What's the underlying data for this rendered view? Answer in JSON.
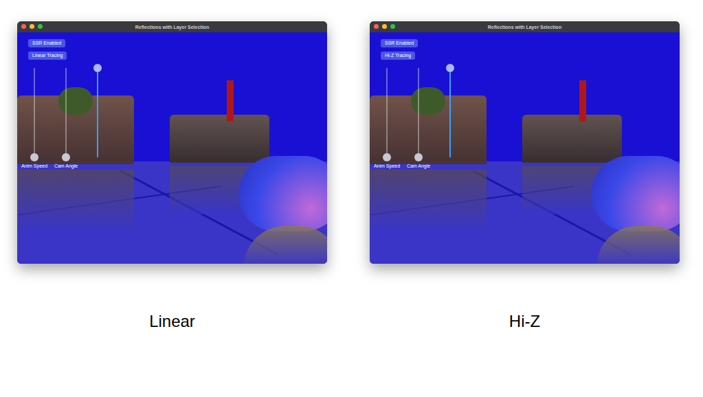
{
  "panels": [
    {
      "window": {
        "title": "Reflections with Layer Selection"
      },
      "buttons": [
        {
          "label": "SSR Enabled"
        },
        {
          "label": "Linear Tracing"
        }
      ],
      "sliders": [
        {
          "label": "Anim Speed",
          "level": 0,
          "selected": false
        },
        {
          "label": "Cam Angle",
          "level": 0,
          "selected": false
        },
        {
          "level": 1,
          "selected": true
        }
      ],
      "caption": "Linear"
    },
    {
      "window": {
        "title": "Reflections with Layer Selection"
      },
      "buttons": [
        {
          "label": "SSR Enabled"
        },
        {
          "label": "Hi-Z Tracing"
        }
      ],
      "sliders": [
        {
          "label": "Anim Speed",
          "level": 0,
          "selected": false
        },
        {
          "label": "Cam Angle",
          "level": 0,
          "selected": false
        },
        {
          "level": 1,
          "selected": true
        }
      ],
      "caption": "Hi-Z"
    }
  ]
}
